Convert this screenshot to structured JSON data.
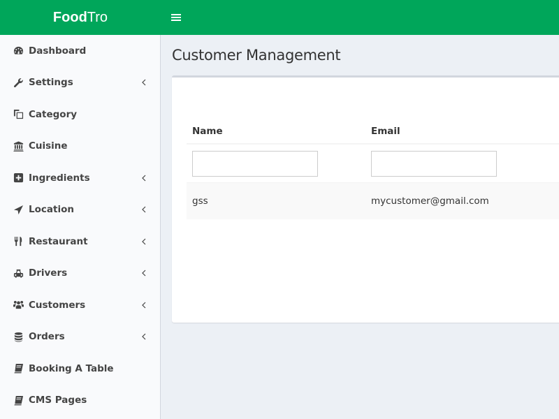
{
  "app": {
    "logo_bold": "Food",
    "logo_regular": "Tro",
    "brand_color": "#00a65a"
  },
  "header": {
    "menu_toggle_icon": "hamburger-icon"
  },
  "sidebar": {
    "items": [
      {
        "label": "Dashboard",
        "icon": "dashboard-icon",
        "has_submenu": false
      },
      {
        "label": "Settings",
        "icon": "wrench-icon",
        "has_submenu": true
      },
      {
        "label": "Category",
        "icon": "copy-icon",
        "has_submenu": false
      },
      {
        "label": "Cuisine",
        "icon": "bank-icon",
        "has_submenu": false
      },
      {
        "label": "Ingredients",
        "icon": "plus-square-icon",
        "has_submenu": true
      },
      {
        "label": "Location",
        "icon": "location-arrow-icon",
        "has_submenu": true
      },
      {
        "label": "Restaurant",
        "icon": "cutlery-icon",
        "has_submenu": true
      },
      {
        "label": "Drivers",
        "icon": "taxi-icon",
        "has_submenu": true
      },
      {
        "label": "Customers",
        "icon": "users-icon",
        "has_submenu": true
      },
      {
        "label": "Orders",
        "icon": "database-icon",
        "has_submenu": true
      },
      {
        "label": "Booking A Table",
        "icon": "book-icon",
        "has_submenu": false
      },
      {
        "label": "CMS Pages",
        "icon": "book-icon",
        "has_submenu": false
      }
    ]
  },
  "main": {
    "title": "Customer Management",
    "table": {
      "columns": [
        "Name",
        "Email"
      ],
      "filters": [
        {
          "value": "",
          "placeholder": ""
        },
        {
          "value": "",
          "placeholder": ""
        }
      ],
      "rows": [
        {
          "name": "gss",
          "email": "mycustomer@gmail.com"
        }
      ]
    }
  }
}
